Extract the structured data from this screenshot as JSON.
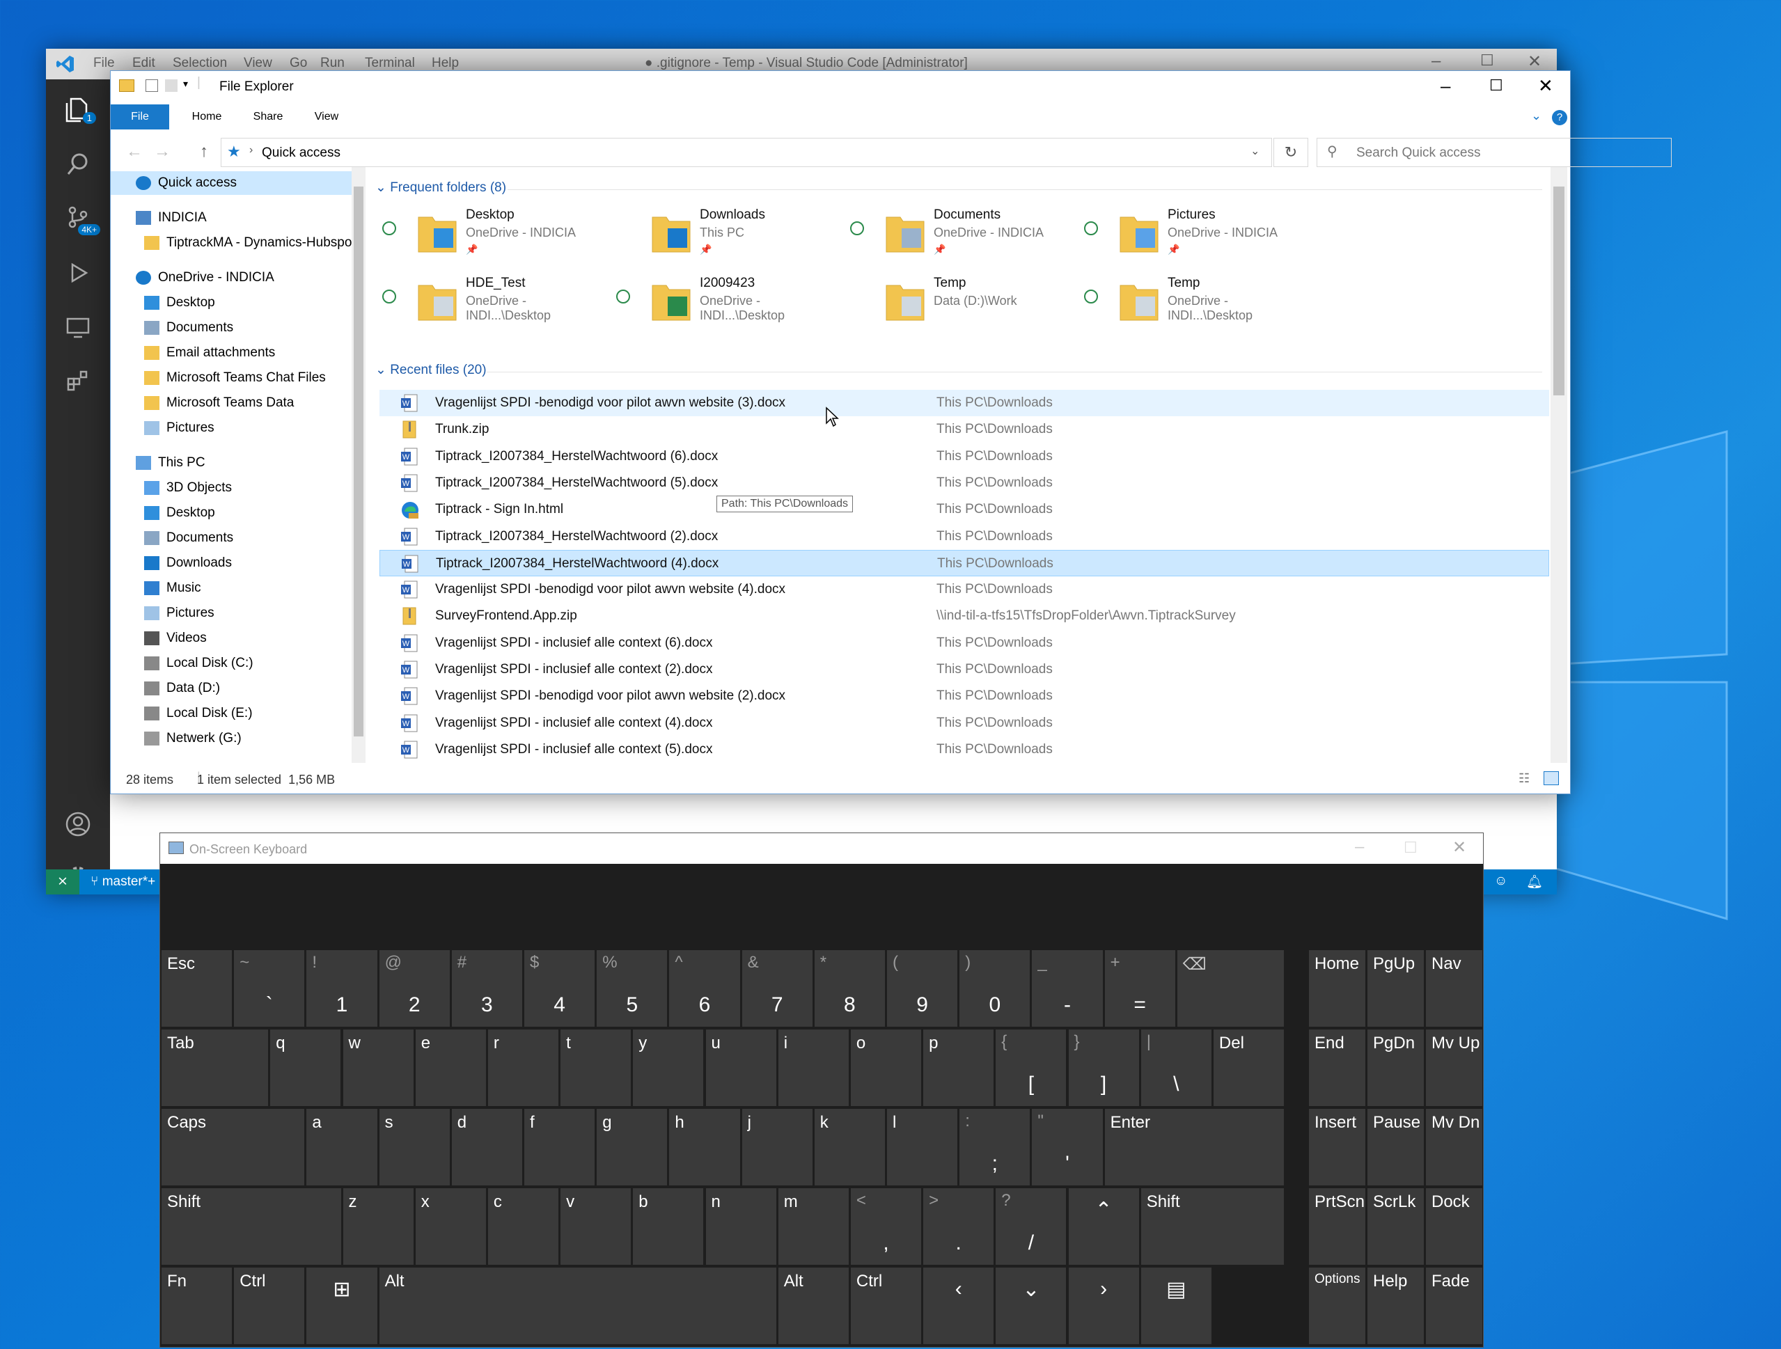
{
  "vscode": {
    "menu": [
      "File",
      "Edit",
      "Selection",
      "View",
      "Go",
      "Run",
      "Terminal",
      "Help"
    ],
    "title": "● .gitignore - Temp - Visual Studio Code [Administrator]",
    "explorer_badge": "1",
    "remote_badge": "4K+",
    "branch": "master*+"
  },
  "explorer": {
    "title": "File Explorer",
    "tabs": [
      "File",
      "Home",
      "Share",
      "View"
    ],
    "address": "Quick access",
    "search_placeholder": "Search Quick access",
    "nav": [
      {
        "label": "Quick access",
        "indent": 0,
        "type": "star",
        "selected": true
      },
      {
        "label": "INDICIA",
        "indent": 0,
        "type": "bldg"
      },
      {
        "label": "TiptrackMA - Dynamics-Hubspot",
        "indent": 1,
        "type": "folder"
      },
      {
        "label": "OneDrive - INDICIA",
        "indent": 0,
        "type": "cloud"
      },
      {
        "label": "Desktop",
        "indent": 1,
        "type": "desk"
      },
      {
        "label": "Documents",
        "indent": 1,
        "type": "docs"
      },
      {
        "label": "Email attachments",
        "indent": 1,
        "type": "folder"
      },
      {
        "label": "Microsoft Teams Chat Files",
        "indent": 1,
        "type": "folder"
      },
      {
        "label": "Microsoft Teams Data",
        "indent": 1,
        "type": "folder"
      },
      {
        "label": "Pictures",
        "indent": 1,
        "type": "pics"
      },
      {
        "label": "This PC",
        "indent": 0,
        "type": "pc"
      },
      {
        "label": "3D Objects",
        "indent": 1,
        "type": "3d"
      },
      {
        "label": "Desktop",
        "indent": 1,
        "type": "desk"
      },
      {
        "label": "Documents",
        "indent": 1,
        "type": "docs"
      },
      {
        "label": "Downloads",
        "indent": 1,
        "type": "dl"
      },
      {
        "label": "Music",
        "indent": 1,
        "type": "music"
      },
      {
        "label": "Pictures",
        "indent": 1,
        "type": "pics"
      },
      {
        "label": "Videos",
        "indent": 1,
        "type": "video"
      },
      {
        "label": "Local Disk (C:)",
        "indent": 1,
        "type": "disk"
      },
      {
        "label": "Data (D:)",
        "indent": 1,
        "type": "disk"
      },
      {
        "label": "Local Disk (E:)",
        "indent": 1,
        "type": "disk"
      },
      {
        "label": "Netwerk (G:)",
        "indent": 1,
        "type": "net"
      }
    ],
    "frequent_header": "Frequent folders (8)",
    "folders": [
      {
        "name": "Desktop",
        "sub": "OneDrive - INDICIA",
        "sync": true,
        "kind": "desk"
      },
      {
        "name": "Downloads",
        "sub": "This PC",
        "sync": false,
        "kind": "dl"
      },
      {
        "name": "Documents",
        "sub": "OneDrive - INDICIA",
        "sync": true,
        "kind": "docs"
      },
      {
        "name": "Pictures",
        "sub": "OneDrive - INDICIA",
        "sync": true,
        "kind": "pics"
      },
      {
        "name": "HDE_Test",
        "sub": "OneDrive - INDI...\\Desktop",
        "sync": true,
        "kind": "doc"
      },
      {
        "name": "I2009423",
        "sub": "OneDrive - INDI...\\Desktop",
        "sync": true,
        "kind": "xls"
      },
      {
        "name": "Temp",
        "sub": "Data (D:)\\Work",
        "sync": false,
        "kind": "doc"
      },
      {
        "name": "Temp",
        "sub": "OneDrive - INDI...\\Desktop",
        "sync": true,
        "kind": "doc"
      }
    ],
    "pin": "📌",
    "recent_header": "Recent files (20)",
    "files": [
      {
        "name": "Vragenlijst SPDI -benodigd voor pilot awvn website (3).docx",
        "path": "This PC\\Downloads",
        "icon": "word",
        "state": "hover"
      },
      {
        "name": "Trunk.zip",
        "path": "This PC\\Downloads",
        "icon": "zip"
      },
      {
        "name": "Tiptrack_I2007384_HerstelWachtwoord (6).docx",
        "path": "This PC\\Downloads",
        "icon": "word"
      },
      {
        "name": "Tiptrack_I2007384_HerstelWachtwoord (5).docx",
        "path": "This PC\\Downloads",
        "icon": "word"
      },
      {
        "name": "Tiptrack - Sign In.html",
        "path": "This PC\\Downloads",
        "icon": "edge"
      },
      {
        "name": "Tiptrack_I2007384_HerstelWachtwoord (2).docx",
        "path": "This PC\\Downloads",
        "icon": "word"
      },
      {
        "name": "Tiptrack_I2007384_HerstelWachtwoord (4).docx",
        "path": "This PC\\Downloads",
        "icon": "word",
        "state": "selected"
      },
      {
        "name": "Vragenlijst SPDI -benodigd voor pilot awvn website (4).docx",
        "path": "This PC\\Downloads",
        "icon": "word"
      },
      {
        "name": "SurveyFrontend.App.zip",
        "path": "\\\\ind-til-a-tfs15\\TfsDropFolder\\Awvn.TiptrackSurvey",
        "icon": "zip"
      },
      {
        "name": "Vragenlijst SPDI - inclusief alle context (6).docx",
        "path": "This PC\\Downloads",
        "icon": "word"
      },
      {
        "name": "Vragenlijst SPDI - inclusief alle context (2).docx",
        "path": "This PC\\Downloads",
        "icon": "word"
      },
      {
        "name": "Vragenlijst SPDI -benodigd voor pilot awvn website (2).docx",
        "path": "This PC\\Downloads",
        "icon": "word"
      },
      {
        "name": "Vragenlijst SPDI - inclusief alle context (4).docx",
        "path": "This PC\\Downloads",
        "icon": "word"
      },
      {
        "name": "Vragenlijst SPDI - inclusief alle context (5).docx",
        "path": "This PC\\Downloads",
        "icon": "word"
      }
    ],
    "tooltip": "Path: This PC\\Downloads",
    "status_items": "28 items",
    "status_selected": "1 item selected  1,56 MB"
  },
  "osk": {
    "title": "On-Screen Keyboard",
    "rows": [
      [
        {
          "l": "Esc",
          "w": 1
        },
        {
          "s": "~",
          "b": "`",
          "w": 1
        },
        {
          "s": "!",
          "b": "1",
          "w": 1
        },
        {
          "s": "@",
          "b": "2",
          "w": 1
        },
        {
          "s": "#",
          "b": "3",
          "w": 1
        },
        {
          "s": "$",
          "b": "4",
          "w": 1
        },
        {
          "s": "%",
          "b": "5",
          "w": 1
        },
        {
          "s": "^",
          "b": "6",
          "w": 1
        },
        {
          "s": "&",
          "b": "7",
          "w": 1
        },
        {
          "s": "*",
          "b": "8",
          "w": 1
        },
        {
          "s": "(",
          "b": "9",
          "w": 1
        },
        {
          "s": ")",
          "b": "0",
          "w": 1
        },
        {
          "s": "_",
          "b": "-",
          "w": 1
        },
        {
          "s": "+",
          "b": "=",
          "w": 1
        },
        {
          "l": "⌫",
          "w": 1.5
        }
      ],
      [
        {
          "l": "Tab",
          "w": 1.5
        },
        {
          "l": "q",
          "w": 1
        },
        {
          "l": "w",
          "w": 1
        },
        {
          "l": "e",
          "w": 1
        },
        {
          "l": "r",
          "w": 1
        },
        {
          "l": "t",
          "w": 1
        },
        {
          "l": "y",
          "w": 1
        },
        {
          "l": "u",
          "w": 1
        },
        {
          "l": "i",
          "w": 1
        },
        {
          "l": "o",
          "w": 1
        },
        {
          "l": "p",
          "w": 1
        },
        {
          "s": "{",
          "b": "[",
          "w": 1
        },
        {
          "s": "}",
          "b": "]",
          "w": 1
        },
        {
          "s": "|",
          "b": "\\",
          "w": 1
        },
        {
          "l": "Del",
          "w": 1
        }
      ],
      [
        {
          "l": "Caps",
          "w": 2
        },
        {
          "l": "a",
          "w": 1
        },
        {
          "l": "s",
          "w": 1
        },
        {
          "l": "d",
          "w": 1
        },
        {
          "l": "f",
          "w": 1
        },
        {
          "l": "g",
          "w": 1
        },
        {
          "l": "h",
          "w": 1
        },
        {
          "l": "j",
          "w": 1
        },
        {
          "l": "k",
          "w": 1
        },
        {
          "l": "l",
          "w": 1
        },
        {
          "s": ":",
          "b": ";",
          "w": 1
        },
        {
          "s": "\"",
          "b": "'",
          "w": 1
        },
        {
          "l": "Enter",
          "w": 2.5
        }
      ],
      [
        {
          "l": "Shift",
          "w": 2.5
        },
        {
          "l": "z",
          "w": 1
        },
        {
          "l": "x",
          "w": 1
        },
        {
          "l": "c",
          "w": 1
        },
        {
          "l": "v",
          "w": 1
        },
        {
          "l": "b",
          "w": 1
        },
        {
          "l": "n",
          "w": 1
        },
        {
          "l": "m",
          "w": 1
        },
        {
          "s": "<",
          "b": ",",
          "w": 1
        },
        {
          "s": ">",
          "b": ".",
          "w": 1
        },
        {
          "s": "?",
          "b": "/",
          "w": 1
        },
        {
          "c": "⌃",
          "w": 1
        },
        {
          "l": "Shift",
          "w": 2
        }
      ],
      [
        {
          "l": "Fn",
          "w": 1
        },
        {
          "l": "Ctrl",
          "w": 1
        },
        {
          "c": "⊞",
          "w": 1
        },
        {
          "l": "Alt",
          "w": 5.5
        },
        {
          "l": "Alt",
          "w": 1
        },
        {
          "l": "Ctrl",
          "w": 1
        },
        {
          "c": "‹",
          "w": 1
        },
        {
          "c": "⌄",
          "w": 1
        },
        {
          "c": "›",
          "w": 1
        },
        {
          "c": "▤",
          "w": 1
        }
      ]
    ],
    "side": [
      [
        "Home",
        "PgUp",
        "Nav"
      ],
      [
        "End",
        "PgDn",
        "Mv Up"
      ],
      [
        "Insert",
        "Pause",
        "Mv Dn"
      ],
      [
        "PrtScn",
        "ScrLk",
        "Dock"
      ],
      [
        "Options",
        "Help",
        "Fade"
      ]
    ]
  },
  "colors": {
    "accent": "#0078d7",
    "vs_status": "#007acc",
    "selected_row": "#cce8ff",
    "hover_row": "#e5f3ff",
    "osk_key": "#3a3a3a"
  }
}
